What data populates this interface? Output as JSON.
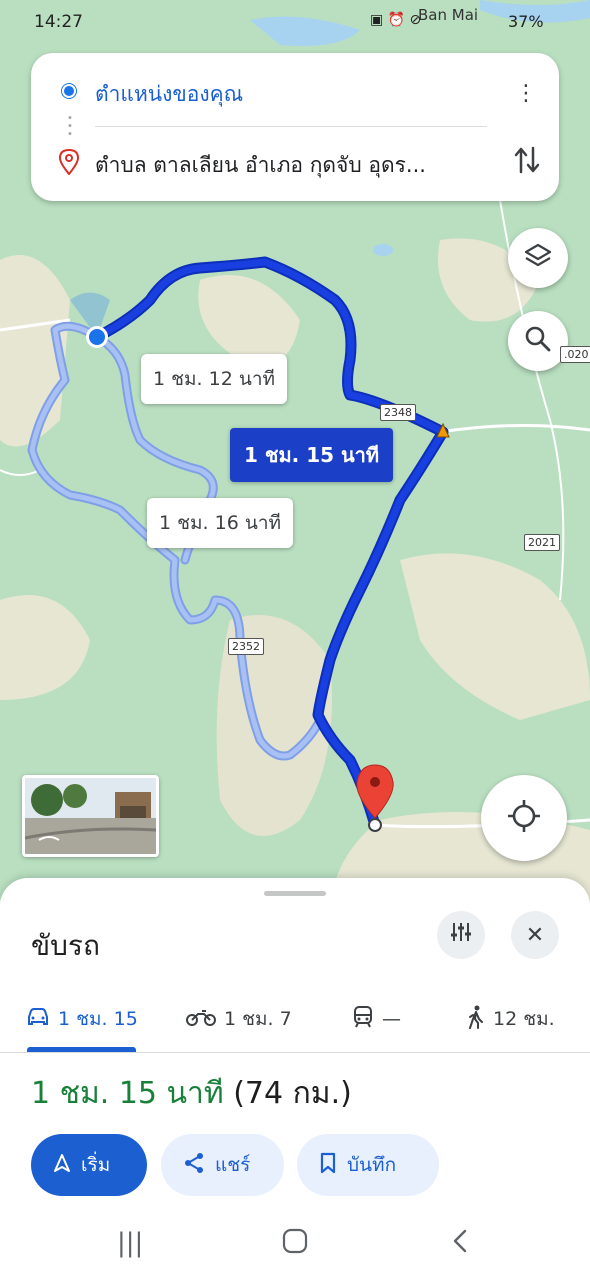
{
  "status_bar": {
    "time": "14:27",
    "place": "Ban Mai",
    "battery": "37%"
  },
  "route_card": {
    "origin": "ตำแหน่งของคุณ",
    "destination": "ตำบล ตาลเลียน อำเภอ กุดจับ อุดร..."
  },
  "map": {
    "route_labels": {
      "alt1": "1 ชม. 12 นาที",
      "main": "1 ชม. 15 นาที",
      "alt2": "1 ชม. 16 นาที"
    },
    "road_shields": {
      "r2348": "2348",
      "r2352": "2352",
      "r2021": "2021",
      "r2020": ".020"
    },
    "colors": {
      "route_main": "#1a3fe0",
      "route_alt": "#9bb6f0",
      "map_green": "#b9dfc0",
      "map_beige": "#eaeadb"
    }
  },
  "sheet": {
    "mode_title": "ขับรถ",
    "tabs": {
      "car": "1 ชม. 15",
      "motorbike": "1 ชม. 7",
      "transit": "—",
      "walk": "12 ชม."
    },
    "summary": {
      "duration": "1 ชม. 15 นาที",
      "distance": "(74 กม.)"
    },
    "actions": {
      "start": "เริ่ม",
      "share": "แชร์",
      "save": "บันทึก"
    }
  }
}
